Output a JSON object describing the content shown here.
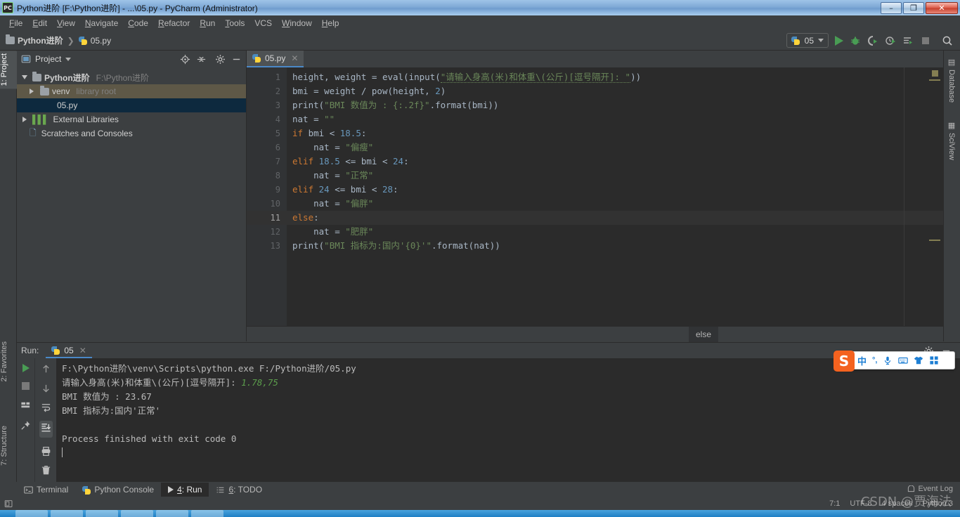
{
  "window": {
    "title": "Python进阶 [F:\\Python进阶] - ...\\05.py - PyCharm (Administrator)",
    "app_icon": "pycharm-icon",
    "minimize": "–",
    "restore": "❐",
    "close": "✕"
  },
  "menubar": [
    {
      "label": "File",
      "mnemonic": "F"
    },
    {
      "label": "Edit",
      "mnemonic": "E"
    },
    {
      "label": "View",
      "mnemonic": "V"
    },
    {
      "label": "Navigate",
      "mnemonic": "N"
    },
    {
      "label": "Code",
      "mnemonic": "C"
    },
    {
      "label": "Refactor",
      "mnemonic": "R"
    },
    {
      "label": "Run",
      "mnemonic": "R"
    },
    {
      "label": "Tools",
      "mnemonic": "T"
    },
    {
      "label": "VCS",
      "mnemonic": ""
    },
    {
      "label": "Window",
      "mnemonic": "W"
    },
    {
      "label": "Help",
      "mnemonic": "H"
    }
  ],
  "toolbar": {
    "breadcrumb_project": "Python进阶",
    "breadcrumb_sep": "❯",
    "breadcrumb_file": "05.py",
    "run_config_name": "05",
    "icons": [
      "run-icon",
      "debug-icon",
      "coverage-icon",
      "profile-icon",
      "run-with-console-icon",
      "stop-icon",
      "search-everywhere-icon"
    ]
  },
  "left_strip": {
    "project_tab": "1: Project",
    "favorites_tab": "2: Favorites",
    "structure_tab": "7: Structure"
  },
  "right_strip": {
    "database_tab": "Database",
    "sciview_tab": "SciView"
  },
  "project_panel": {
    "title": "Project",
    "tools": [
      "locate-icon",
      "collapse-all-icon",
      "settings-gear-icon",
      "hide-icon"
    ],
    "tree": [
      {
        "label": "Python进阶",
        "hint": "F:\\Python进阶",
        "depth": 0,
        "state": "expanded",
        "icon": "folder-icon",
        "selected": false,
        "highlight": false
      },
      {
        "label": "venv",
        "hint": "library root",
        "depth": 1,
        "state": "collapsed",
        "icon": "folder-icon",
        "selected": false,
        "highlight": true
      },
      {
        "label": "05.py",
        "hint": "",
        "depth": 2,
        "state": "leaf",
        "icon": "python-file-icon",
        "selected": true,
        "highlight": false
      },
      {
        "label": "External Libraries",
        "hint": "",
        "depth": 0,
        "state": "collapsed",
        "icon": "libraries-icon",
        "selected": false,
        "highlight": false
      },
      {
        "label": "Scratches and Consoles",
        "hint": "",
        "depth": 0,
        "state": "leaf",
        "icon": "scratches-icon",
        "selected": false,
        "highlight": false
      }
    ]
  },
  "editor": {
    "tab_label": "05.py",
    "tab_close": "✕",
    "breadcrumb_status": "else",
    "current_line": 11,
    "lines": [
      {
        "n": 1,
        "tokens": [
          {
            "t": "height, weight ",
            "c": "p"
          },
          {
            "t": "= ",
            "c": "p"
          },
          {
            "t": "eval",
            "c": "p"
          },
          {
            "t": "(",
            "c": "p"
          },
          {
            "t": "input",
            "c": "p"
          },
          {
            "t": "(",
            "c": "p"
          },
          {
            "t": "\"请输入身高(米)和体重\\(公斤)[逗号隔开]: \"",
            "c": "s typo"
          },
          {
            "t": "))",
            "c": "p"
          }
        ]
      },
      {
        "n": 2,
        "tokens": [
          {
            "t": "bmi = weight / ",
            "c": "p"
          },
          {
            "t": "pow",
            "c": "p"
          },
          {
            "t": "(height, ",
            "c": "p"
          },
          {
            "t": "2",
            "c": "n"
          },
          {
            "t": ")",
            "c": "p"
          }
        ]
      },
      {
        "n": 3,
        "tokens": [
          {
            "t": "print",
            "c": "p"
          },
          {
            "t": "(",
            "c": "p"
          },
          {
            "t": "\"BMI 数值为 : {:.2f}\"",
            "c": "s"
          },
          {
            "t": ".format(bmi))",
            "c": "p"
          }
        ]
      },
      {
        "n": 4,
        "tokens": [
          {
            "t": "nat = ",
            "c": "p"
          },
          {
            "t": "\"\"",
            "c": "s"
          }
        ]
      },
      {
        "n": 5,
        "tokens": [
          {
            "t": "if",
            "c": "k"
          },
          {
            "t": " bmi < ",
            "c": "p"
          },
          {
            "t": "18.5",
            "c": "n"
          },
          {
            "t": ":",
            "c": "p"
          }
        ]
      },
      {
        "n": 6,
        "tokens": [
          {
            "t": "    nat = ",
            "c": "p"
          },
          {
            "t": "\"偏瘦\"",
            "c": "s"
          }
        ]
      },
      {
        "n": 7,
        "tokens": [
          {
            "t": "elif",
            "c": "k"
          },
          {
            "t": " ",
            "c": "p"
          },
          {
            "t": "18.5",
            "c": "n"
          },
          {
            "t": " <= bmi < ",
            "c": "p"
          },
          {
            "t": "24",
            "c": "n"
          },
          {
            "t": ":",
            "c": "p"
          }
        ]
      },
      {
        "n": 8,
        "tokens": [
          {
            "t": "    nat = ",
            "c": "p"
          },
          {
            "t": "\"正常\"",
            "c": "s"
          }
        ]
      },
      {
        "n": 9,
        "tokens": [
          {
            "t": "elif",
            "c": "k"
          },
          {
            "t": " ",
            "c": "p"
          },
          {
            "t": "24",
            "c": "n"
          },
          {
            "t": " <= bmi < ",
            "c": "p"
          },
          {
            "t": "28",
            "c": "n"
          },
          {
            "t": ":",
            "c": "p"
          }
        ]
      },
      {
        "n": 10,
        "tokens": [
          {
            "t": "    nat = ",
            "c": "p"
          },
          {
            "t": "\"偏胖\"",
            "c": "s"
          }
        ]
      },
      {
        "n": 11,
        "tokens": [
          {
            "t": "else",
            "c": "k"
          },
          {
            "t": ":",
            "c": "p"
          }
        ]
      },
      {
        "n": 12,
        "tokens": [
          {
            "t": "    nat = ",
            "c": "p"
          },
          {
            "t": "\"肥胖\"",
            "c": "s"
          }
        ]
      },
      {
        "n": 13,
        "tokens": [
          {
            "t": "print",
            "c": "p"
          },
          {
            "t": "(",
            "c": "p"
          },
          {
            "t": "\"BMI 指标为:国内'{0}'\"",
            "c": "s"
          },
          {
            "t": ".format(nat))",
            "c": "p"
          }
        ]
      }
    ]
  },
  "run_panel": {
    "label": "Run:",
    "tab_label": "05",
    "tab_close": "✕",
    "tools_left": [
      "rerun-icon",
      "stop-icon",
      "restore-layout-icon",
      "pin-tab-icon"
    ],
    "tools_right": [
      "up-arrow-icon",
      "down-arrow-icon",
      "soft-wrap-icon",
      "scroll-to-end-icon",
      "print-icon",
      "trash-icon"
    ],
    "header_icons": [
      "settings-gear-icon",
      "hide-icon"
    ],
    "console": [
      {
        "text": "F:\\Python进阶\\venv\\Scripts\\python.exe F:/Python进阶/05.py",
        "type": "normal"
      },
      {
        "text": "请输入身高(米)和体重\\(公斤)[逗号隔开]: ",
        "input": "1.78,75",
        "type": "prompt"
      },
      {
        "text": "BMI 数值为 : 23.67",
        "type": "normal"
      },
      {
        "text": "BMI 指标为:国内'正常'",
        "type": "normal"
      },
      {
        "text": "",
        "type": "normal"
      },
      {
        "text": "Process finished with exit code 0",
        "type": "normal"
      }
    ]
  },
  "ime": {
    "logo": "S",
    "items": [
      "中",
      "°,",
      "mic-icon",
      "keyboard-icon",
      "skin-icon",
      "tools-grid-icon"
    ]
  },
  "bottom_tabs": [
    {
      "label": "Terminal",
      "mnemonic": "",
      "icon": "terminal-icon",
      "selected": false
    },
    {
      "label": "Python Console",
      "mnemonic": "",
      "icon": "python-console-icon",
      "selected": false
    },
    {
      "label": "4: Run",
      "mnemonic": "4",
      "icon": "run-icon",
      "selected": true
    },
    {
      "label": "6: TODO",
      "mnemonic": "6",
      "icon": "todo-icon",
      "selected": false
    }
  ],
  "status_bar": {
    "event_log": "Event Log",
    "caret_position": "7:1",
    "encoding": "UTF-8",
    "indent": "4 spaces",
    "interpreter": "Python 3",
    "watermark": "CSDN @贾海法"
  },
  "colors": {
    "accent_blue": "#4a88c7",
    "run_green": "#499c54",
    "selection": "#0d293e",
    "editor_bg": "#2b2b2b",
    "panel_bg": "#3c3f41",
    "string_green": "#6a8759",
    "keyword_orange": "#cc7832",
    "number_blue": "#6897bb"
  }
}
